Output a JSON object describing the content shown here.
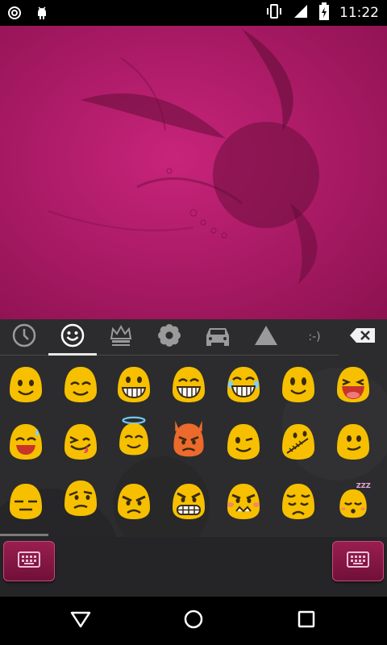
{
  "status_bar": {
    "time": "11:22",
    "icons": [
      "target-icon",
      "android-icon",
      "vibrate-icon",
      "signal-icon",
      "battery-charging-icon"
    ]
  },
  "keyboard": {
    "tabs": [
      {
        "name": "recent",
        "icon": "clock-icon",
        "selected": false
      },
      {
        "name": "smileys",
        "icon": "smiley-icon",
        "selected": true
      },
      {
        "name": "objects",
        "icon": "crown-icon",
        "selected": false
      },
      {
        "name": "nature",
        "icon": "flower-icon",
        "selected": false
      },
      {
        "name": "places",
        "icon": "car-icon",
        "selected": false
      },
      {
        "name": "symbols",
        "icon": "triangle-icon",
        "selected": false
      },
      {
        "name": "emoticons",
        "icon": "emoticon-text",
        "label": ":-)",
        "selected": false
      }
    ],
    "delete_icon": "backspace-icon",
    "emojis": [
      "smile",
      "blush",
      "grin",
      "grinning",
      "joy",
      "smiley",
      "laughing",
      "sweat-smile",
      "squint-laugh",
      "innocent",
      "imp",
      "wink",
      "zipper-mouth",
      "slight-smile",
      "expressionless",
      "unamused",
      "angry",
      "grimacing",
      "pouting",
      "pensive",
      "sleepy"
    ],
    "left_button_icon": "keyboard-icon",
    "right_button_icon": "keyboard-icon"
  },
  "navbar": {
    "icons": [
      "back-icon",
      "home-icon",
      "recents-icon"
    ]
  },
  "colors": {
    "wallpaper": "#b01a68",
    "keyboard_bg": "#2b2b2d",
    "emoji_yellow": "#f6c000",
    "emoji_orange": "#ec6a2c",
    "button": "#8a1848"
  }
}
